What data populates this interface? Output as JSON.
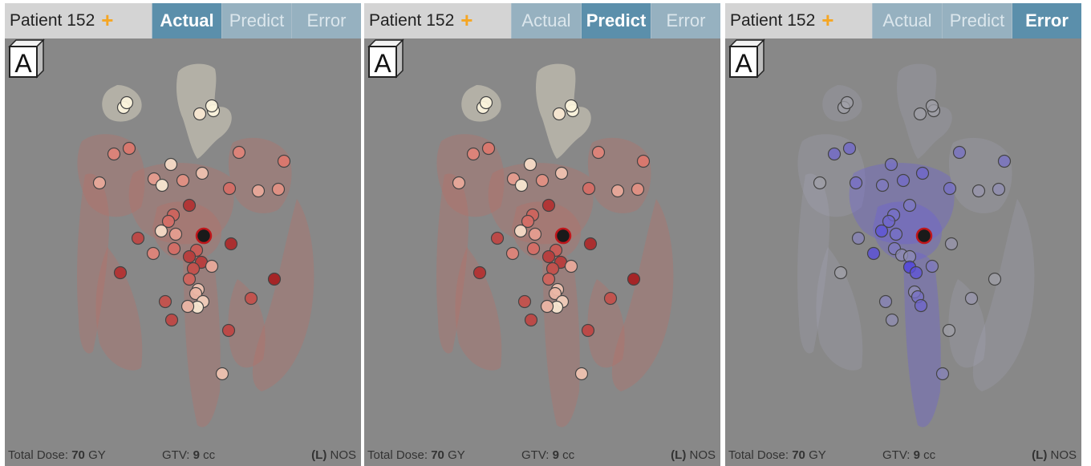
{
  "panels": [
    {
      "patient": "Patient 152",
      "tabs": [
        {
          "label": "Actual",
          "active": true
        },
        {
          "label": "Predict",
          "active": false
        },
        {
          "label": "Error",
          "active": false
        }
      ],
      "total_dose_label": "Total Dose:",
      "total_dose_value": "70",
      "total_dose_unit": "GY",
      "gtv_label": "GTV:",
      "gtv_value": "9",
      "gtv_unit": "cc",
      "laterality": "(L)",
      "site": "NOS",
      "orientation": "A",
      "mode": "dose"
    },
    {
      "patient": "Patient 152",
      "tabs": [
        {
          "label": "Actual",
          "active": false
        },
        {
          "label": "Predict",
          "active": true
        },
        {
          "label": "Error",
          "active": false
        }
      ],
      "total_dose_label": "Total Dose:",
      "total_dose_value": "70",
      "total_dose_unit": "GY",
      "gtv_label": "GTV:",
      "gtv_value": "9",
      "gtv_unit": "cc",
      "laterality": "(L)",
      "site": "NOS",
      "orientation": "A",
      "mode": "dose"
    },
    {
      "patient": "Patient 152",
      "tabs": [
        {
          "label": "Actual",
          "active": false
        },
        {
          "label": "Predict",
          "active": false
        },
        {
          "label": "Error",
          "active": true
        }
      ],
      "total_dose_label": "Total Dose:",
      "total_dose_value": "70",
      "total_dose_unit": "GY",
      "gtv_label": "GTV:",
      "gtv_value": "9",
      "gtv_unit": "cc",
      "laterality": "(L)",
      "site": "NOS",
      "orientation": "A",
      "mode": "error"
    }
  ],
  "colors": {
    "accent": "#5b8fab",
    "tab_inactive": "#96b1c0",
    "plus": "#f5a623",
    "viewport_bg": "#888888",
    "dose_high": "#a3161a",
    "dose_low": "#fbf3dc",
    "error": "#6a60e0"
  },
  "icons": {
    "add": "plus-icon",
    "orientation_cube": "orientation-cube-icon"
  }
}
